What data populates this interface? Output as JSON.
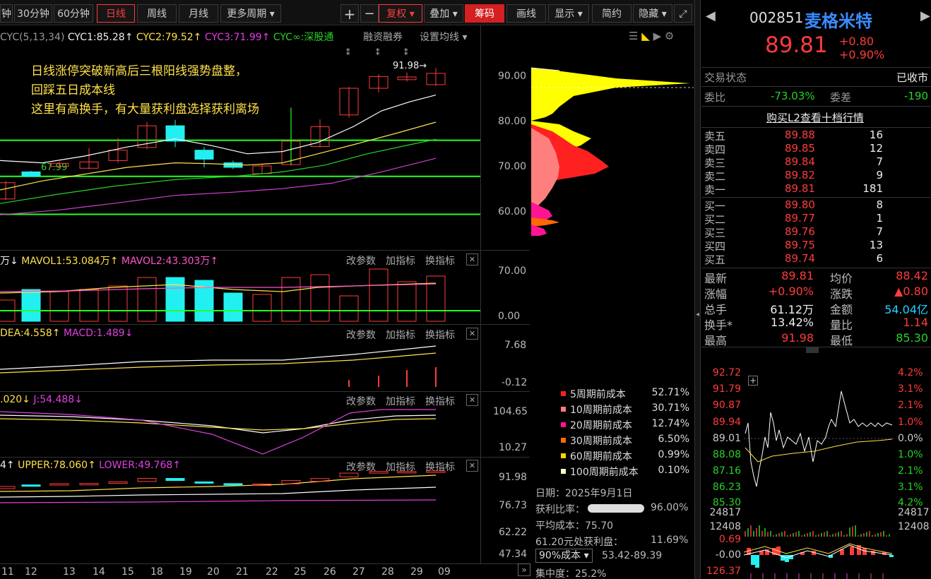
{
  "toolbar": {
    "period_buttons": [
      "钟",
      "30分钟",
      "60分钟",
      "日线",
      "周线",
      "月线",
      "更多周期"
    ],
    "plus": "+",
    "minus": "−",
    "fuquan": "复权",
    "overlay": "叠加",
    "chips": "筹码",
    "draw": "画线",
    "display": "显示",
    "simple": "简约",
    "hide": "隐藏"
  },
  "main_chart": {
    "cyc_labels": [
      "CYC(5,13,34)",
      "CYC1:85.28↑",
      "CYC2:79.52↑",
      "CYC3:71.99↑",
      "CYC∞:深股通",
      "融资融券",
      "设置均线"
    ],
    "annotation": [
      "日线涨停突破新高后三根阳线强势盘整，",
      "回踩五日成本线",
      "这里有高换手，有大量获利盘选择获利离场"
    ],
    "high_label": "91.98→",
    "low_label": "67.99",
    "y_ticks": [
      "90.00",
      "80.00",
      "70.00",
      "60.00"
    ]
  },
  "vol_pane": {
    "labels": [
      "万↓",
      "MAVOL1:53.084万↑",
      "MAVOL2:43.303万↑"
    ],
    "y_ticks": [
      "70.00",
      "0.00"
    ]
  },
  "macd_pane": {
    "labels": [
      "DEA:4.558↑",
      "MACD:1.489↓"
    ],
    "y_ticks": [
      "7.68",
      "-0.12"
    ]
  },
  "kdj_pane": {
    "labels": [
      ".020↓",
      "J:54.488↓"
    ],
    "y_ticks": [
      "104.65",
      "10.27"
    ]
  },
  "boll_pane": {
    "labels": [
      "4↑",
      "UPPER:78.060↑",
      "LOWER:49.768↑"
    ],
    "y_ticks": [
      "91.98",
      "76.73",
      "62.22",
      "47.34"
    ]
  },
  "pane_buttons": [
    "改参数",
    "加指标",
    "换指标",
    "✕"
  ],
  "x_dates": [
    "11",
    "12",
    "13",
    "14",
    "15",
    "18",
    "19",
    "20",
    "21",
    "22",
    "25",
    "26",
    "27",
    "28",
    "29",
    "09"
  ],
  "chips_legend": [
    {
      "label": "5周期前成本",
      "value": "52.71%",
      "color": "#ff2020"
    },
    {
      "label": "10周期前成本",
      "value": "30.71%",
      "color": "#ff7f7f"
    },
    {
      "label": "20周期前成本",
      "value": "12.74%",
      "color": "#ff1493"
    },
    {
      "label": "30周期前成本",
      "value": "6.50%",
      "color": "#ff6a00"
    },
    {
      "label": "60周期前成本",
      "value": "0.99%",
      "color": "#ffd400"
    },
    {
      "label": "100周期前成本",
      "value": "0.10%",
      "color": "#ffffcc"
    }
  ],
  "chips_info": {
    "date": "日期：2025年9月1日",
    "profit_ratio_label": "获利比率：",
    "profit_ratio": "96.00%",
    "avg_cost": "平均成本：75.70",
    "profit_at": "61.20元处获利盘：",
    "profit_at_value": "11.69%",
    "cost90": "90%成本",
    "cost90_range": "53.42-89.39",
    "concentration": "集中度：25.2%"
  },
  "stock": {
    "code": "002851",
    "name": "麦格米特",
    "price": "89.81",
    "change": "+0.80",
    "change_pct": "+0.90%",
    "status_label": "交易状态",
    "status": "已收市",
    "weibi_label": "委比",
    "weibi": "-73.03%",
    "weicha_label": "委差",
    "weicha": "-190",
    "l2_link": "购买L2查看十档行情"
  },
  "order_book": {
    "sells": [
      {
        "label": "卖五",
        "price": "89.88",
        "vol": "16"
      },
      {
        "label": "卖四",
        "price": "89.85",
        "vol": "12"
      },
      {
        "label": "卖三",
        "price": "89.84",
        "vol": "7"
      },
      {
        "label": "卖二",
        "price": "89.82",
        "vol": "9"
      },
      {
        "label": "卖一",
        "price": "89.81",
        "vol": "181"
      }
    ],
    "buys": [
      {
        "label": "买一",
        "price": "89.80",
        "vol": "8"
      },
      {
        "label": "买二",
        "price": "89.77",
        "vol": "1"
      },
      {
        "label": "买三",
        "price": "89.76",
        "vol": "7"
      },
      {
        "label": "买四",
        "price": "89.75",
        "vol": "13"
      },
      {
        "label": "买五",
        "price": "89.74",
        "vol": "6"
      }
    ]
  },
  "quote": [
    {
      "l": "最新",
      "v": "89.81",
      "vc": "red",
      "l2": "均价",
      "v2": "88.42",
      "v2c": "red"
    },
    {
      "l": "涨幅",
      "v": "+0.90%",
      "vc": "red",
      "l2": "涨跌",
      "v2": "▲0.80",
      "v2c": "red"
    },
    {
      "l": "总手",
      "v": "61.12万",
      "vc": "white",
      "l2": "金额",
      "v2": "54.04亿",
      "v2c": "cyan"
    },
    {
      "l": "换手*",
      "v": "13.42%",
      "vc": "white",
      "l2": "量比",
      "v2": "1.14",
      "v2c": "red"
    },
    {
      "l": "最高",
      "v": "91.98",
      "vc": "red",
      "l2": "最低",
      "v2": "85.30",
      "v2c": "green"
    }
  ],
  "intraday": {
    "left_ticks": [
      "92.72",
      "91.79",
      "90.87",
      "89.94",
      "89.01",
      "88.08",
      "87.16",
      "86.23",
      "85.30"
    ],
    "right_ticks": [
      "4.2%",
      "3.1%",
      "2.1%",
      "1.0%",
      "0.0%",
      "1.0%",
      "2.1%",
      "3.1%",
      "4.2%"
    ],
    "vol_ticks": [
      "24817",
      "12408"
    ],
    "macd_ticks": [
      "0.69",
      "-0.00"
    ],
    "bottom_tick": "126.37"
  },
  "colors": {
    "up": "#ff3b3b",
    "down": "#22f0f0",
    "ma_white": "#ffffff",
    "ma_yellow": "#ffe14a",
    "ma_green": "#28d228",
    "ma_magenta": "#d040d0",
    "hline": "#22ff22"
  }
}
